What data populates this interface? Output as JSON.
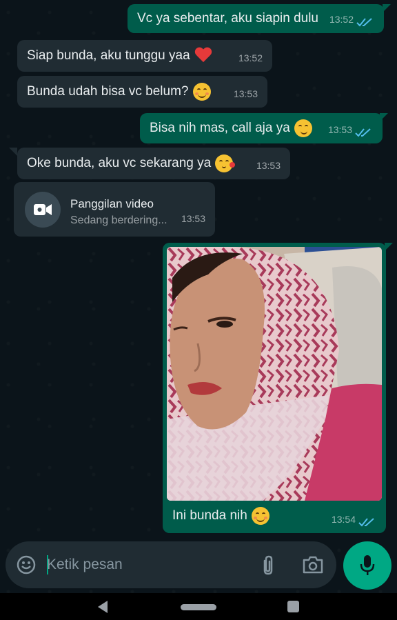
{
  "messages": [
    {
      "dir": "out",
      "text": "Vc ya sebentar, aku siapin dulu",
      "time": "13:52",
      "emoji": ""
    },
    {
      "dir": "in",
      "text": "Siap bunda, aku tunggu yaa",
      "time": "13:52",
      "emoji": "heart-emoji"
    },
    {
      "dir": "in",
      "text": "Bunda udah bisa vc belum?",
      "time": "13:53",
      "emoji": "smiling-face-emoji"
    },
    {
      "dir": "out",
      "text": "Bisa nih mas, call aja ya",
      "time": "13:53",
      "emoji": "smirking-face-emoji"
    },
    {
      "dir": "in",
      "text": "Oke bunda, aku vc sekarang ya",
      "time": "13:53",
      "emoji": "face-blowing-kiss-emoji"
    }
  ],
  "call": {
    "title": "Panggilan video",
    "status": "Sedang berdering...",
    "time": "13:53",
    "icon": "video-camera-icon"
  },
  "photo_message": {
    "caption": "Ini bunda nih",
    "time": "13:54",
    "emoji": "smiling-face-emoji"
  },
  "input": {
    "placeholder": "Ketik pesan",
    "emoji_icon": "emoji-icon",
    "attach_icon": "paperclip-icon",
    "camera_icon": "camera-icon",
    "mic_icon": "microphone-icon"
  },
  "navigation": {
    "back_icon": "back-triangle-icon",
    "home_icon": "home-pill-icon",
    "recents_icon": "recents-square-icon"
  },
  "colors": {
    "background": "#0b141a",
    "incoming": "#202c33",
    "outgoing": "#005c4b",
    "accent": "#00a884",
    "read_ticks": "#53bdeb"
  }
}
